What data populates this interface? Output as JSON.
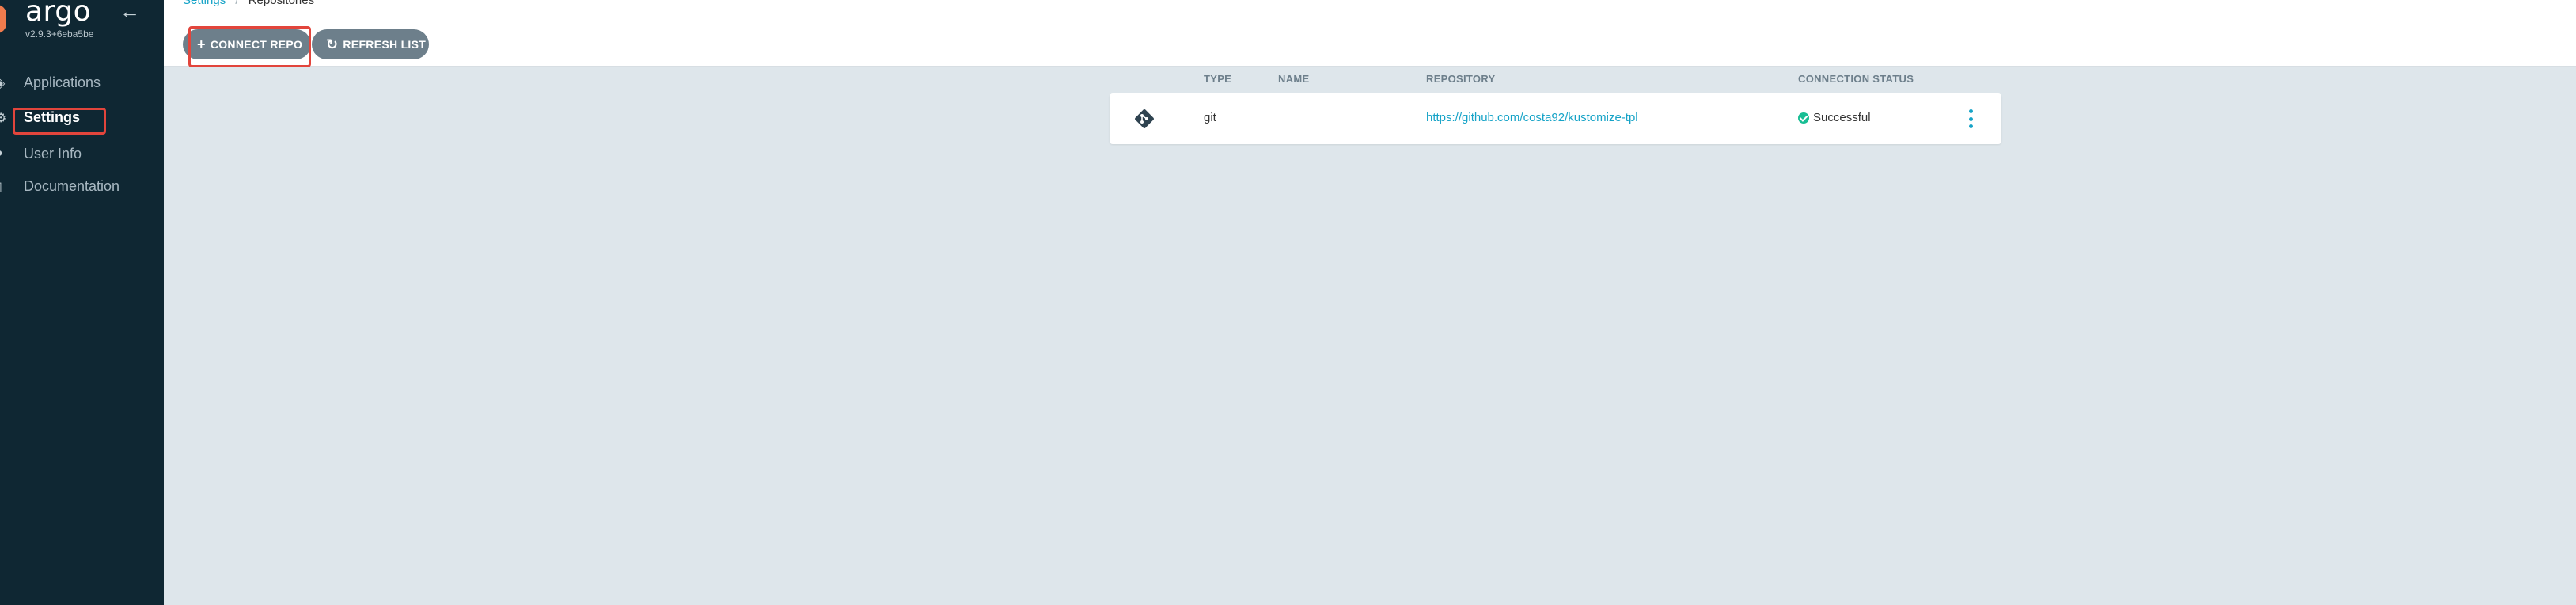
{
  "sidebar": {
    "logo": "argo",
    "version": "v2.9.3+6eba5be",
    "items": [
      {
        "label": "Applications",
        "icon": "stack-icon"
      },
      {
        "label": "Settings",
        "icon": "gear-icon"
      },
      {
        "label": "User Info",
        "icon": "user-icon"
      },
      {
        "label": "Documentation",
        "icon": "book-icon"
      }
    ]
  },
  "breadcrumb": {
    "parent": "Settings",
    "current": "Repositories"
  },
  "toolbar": {
    "connect_label": "CONNECT REPO",
    "refresh_label": "REFRESH LIST"
  },
  "table": {
    "columns": [
      "TYPE",
      "NAME",
      "REPOSITORY",
      "CONNECTION STATUS"
    ],
    "rows": [
      {
        "type": "git",
        "name": "",
        "repository": "https://github.com/costa92/kustomize-tpl",
        "status": "Successful"
      }
    ]
  },
  "colors": {
    "sidebar_bg": "#0f2733",
    "accent": "#16a3c7",
    "success": "#18be94",
    "highlight": "#e2453c"
  }
}
